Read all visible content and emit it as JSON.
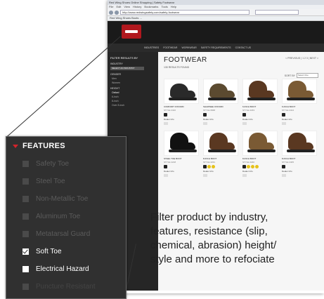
{
  "browser": {
    "title_text": "Red Wing Shoes Online Shopping | Safety Footwear",
    "menu": [
      "File",
      "Edit",
      "View",
      "History",
      "Bookmarks",
      "Tools",
      "Help"
    ],
    "url": "http://www.redwingsafety.com/safety-footwear",
    "bookmark": "Red Wing Shoes Boots ..."
  },
  "site": {
    "nav": [
      "Industries",
      "Footwear",
      "Workwear",
      "Safety Requirements",
      "Contact Us"
    ],
    "page_title": "FOOTWEAR",
    "results_text": "130 RESULTS FOUND",
    "pager_text": "< PREVIOUS | 1 2 3 | NEXT >",
    "sort_label": "SORT BY",
    "sort_value": "Select One",
    "sidebar": {
      "title": "FILTER RESULTS BY",
      "industry_heading": "INDUSTRY",
      "industry_select": "SELECT AN INDUSTRY",
      "gender_heading": "GENDER",
      "gender_items": [
        "Men",
        "Women"
      ],
      "height_heading": "HEIGHT",
      "height_items": [
        "Oxford",
        "6-inch",
        "8-inch",
        "Over 8-inch"
      ]
    },
    "products": [
      {
        "name": "COMFORT OXFORD",
        "style": "Style 2410",
        "color": "dark",
        "boot": false,
        "yellow_badges": 0,
        "dealer": "Dealer Info"
      },
      {
        "name": "SHAWNEE OXFORD",
        "style": "Style 6668",
        "color": "olive",
        "boot": false,
        "yellow_badges": 0,
        "dealer": "Dealer Info"
      },
      {
        "name": "6-INCH BOOT",
        "style": "Style 2233",
        "color": "brown",
        "boot": true,
        "yellow_badges": 0,
        "dealer": "Dealer Info"
      },
      {
        "name": "6-INCH BOOT",
        "style": "Style 2414",
        "color": "tan",
        "boot": true,
        "yellow_badges": 0,
        "dealer": "Dealer Info"
      },
      {
        "name": "STEEL TOE BOOT",
        "style": "Style 2218",
        "color": "black",
        "boot": true,
        "yellow_badges": 0,
        "dealer": "Dealer Info"
      },
      {
        "name": "8-INCH BOOT",
        "style": "Style 2231",
        "color": "brown",
        "boot": true,
        "yellow_badges": 2,
        "dealer": "Dealer Info"
      },
      {
        "name": "8-INCH BOOT",
        "style": "Style 2240",
        "color": "tan",
        "boot": true,
        "yellow_badges": 3,
        "dealer": "Dealer Info"
      },
      {
        "name": "8-INCH BOOT",
        "style": "Style 2405",
        "color": "brown",
        "boot": true,
        "yellow_badges": 0,
        "dealer": "Dealer Info"
      }
    ]
  },
  "features_panel": {
    "title": "FEATURES",
    "items": [
      {
        "label": "Safety Toe",
        "state": "inactive"
      },
      {
        "label": "Steel Toe",
        "state": "inactive"
      },
      {
        "label": "Non-Metallic Toe",
        "state": "inactive"
      },
      {
        "label": "Aluminum Toe",
        "state": "inactive"
      },
      {
        "label": "Metatarsal Guard",
        "state": "inactive"
      },
      {
        "label": "Soft Toe",
        "state": "checked"
      },
      {
        "label": "Electrical Hazard",
        "state": "active"
      },
      {
        "label": "Puncture Resistant",
        "state": "partial"
      }
    ]
  },
  "caption": {
    "lines": [
      "Filter product by industry,",
      "features, resistance (slip,",
      "chemical, abrasion) height/",
      "style and more to refociate"
    ]
  },
  "colors": {
    "accent_red": "#d3232a",
    "panel_bg": "#303030"
  }
}
